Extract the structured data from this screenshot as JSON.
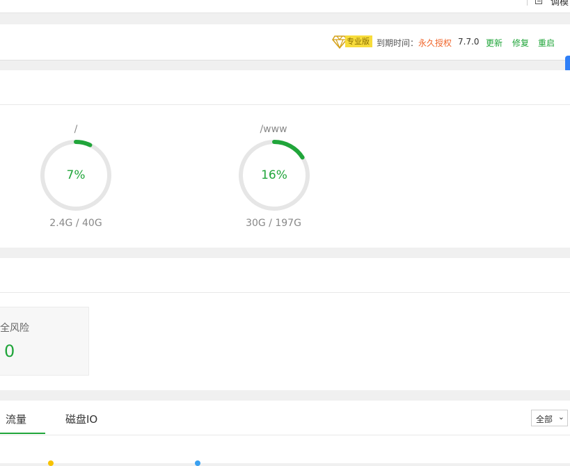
{
  "topbar": {
    "right_text": "调模"
  },
  "header": {
    "pro_label": "专业版",
    "expiry_label": "到期时间：",
    "expiry_value": "永久授权",
    "version": "7.7.0",
    "update": "更新",
    "repair": "修复",
    "restart": "重启"
  },
  "disks": [
    {
      "name": "/",
      "percent": 7,
      "percent_label": "7%",
      "size": "2.4G / 40G"
    },
    {
      "name": "/www",
      "percent": 16,
      "percent_label": "16%",
      "size": "30G / 197G"
    }
  ],
  "security": {
    "label": "全风险",
    "value": "0"
  },
  "traffic": {
    "tabs": [
      "流量",
      "磁盘IO"
    ],
    "active_tab": 0,
    "range": "全部",
    "legend_colors": [
      "#f7c200",
      "#3aa0f0"
    ]
  },
  "colors": {
    "accent": "#20a53a",
    "danger": "#f0652a",
    "ring_track": "#e6e6e6"
  }
}
